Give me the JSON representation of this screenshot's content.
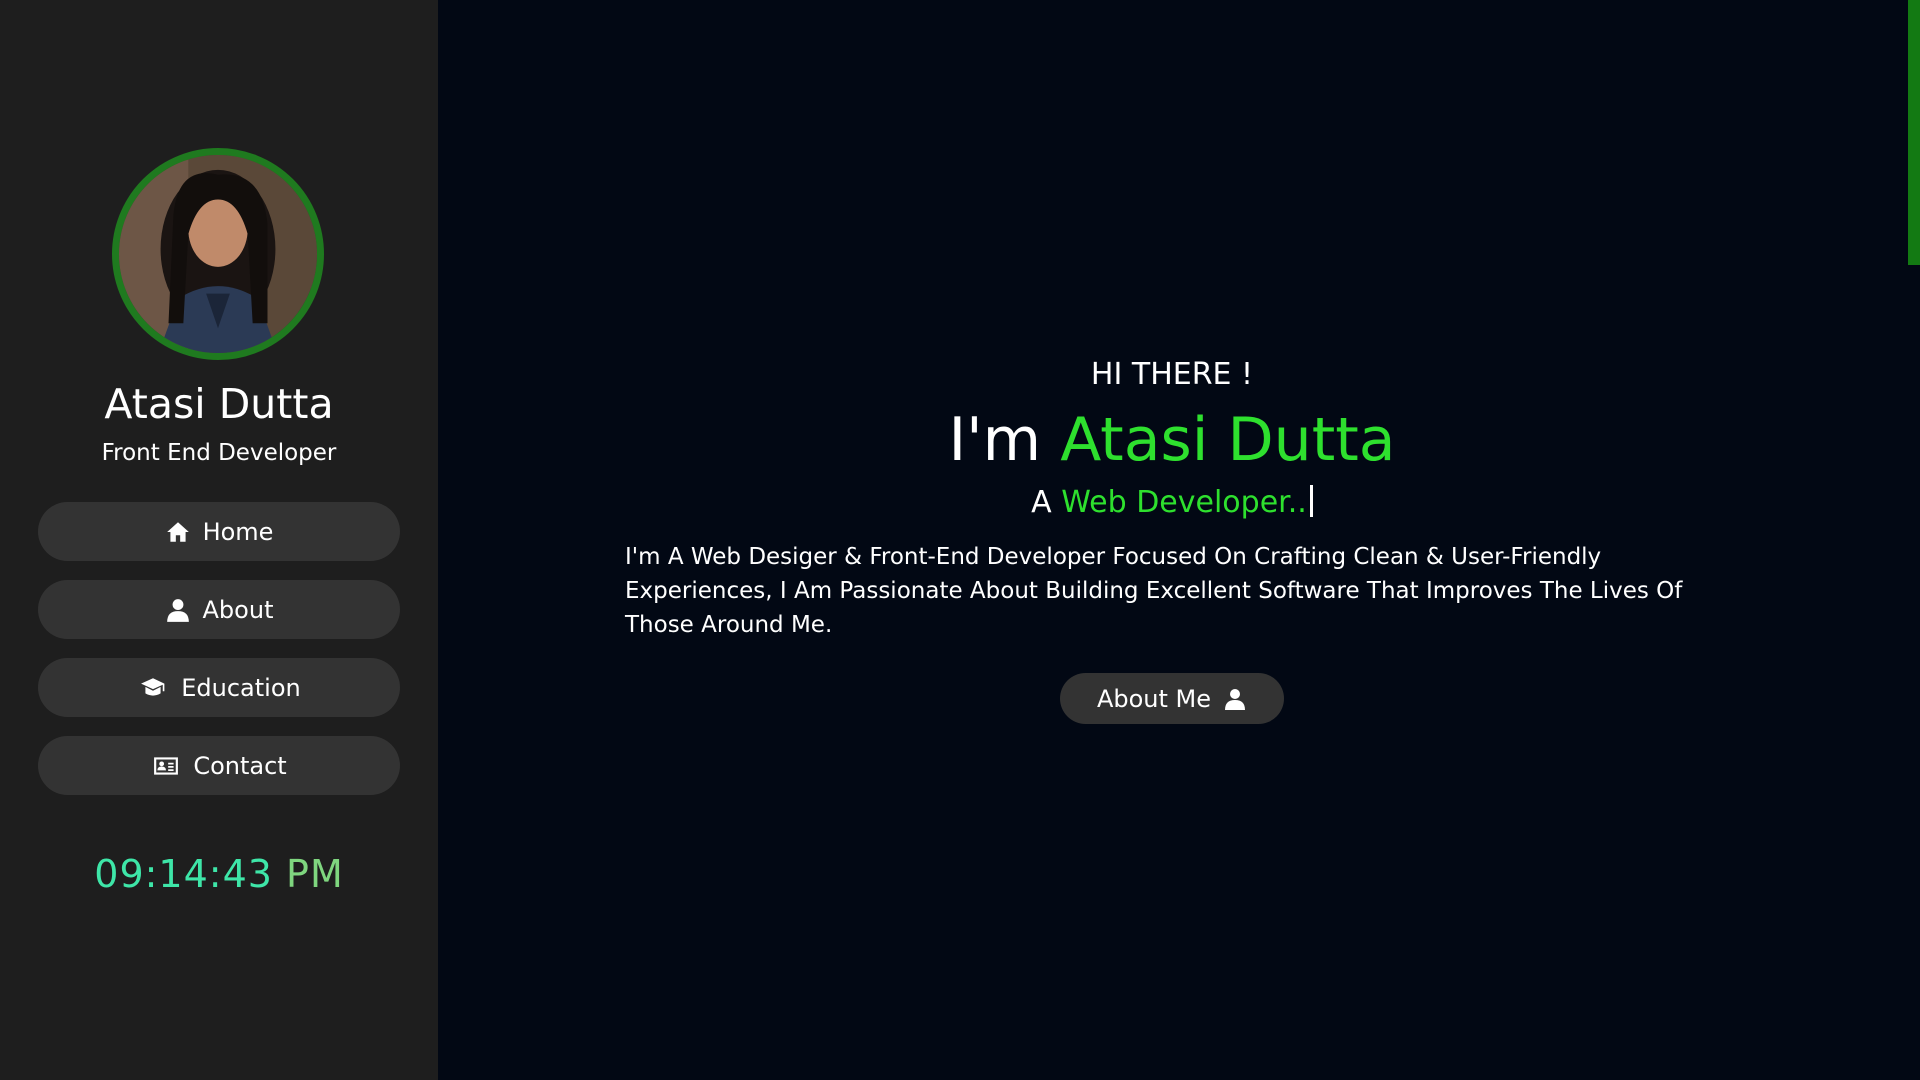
{
  "sidebar": {
    "name": "Atasi Dutta",
    "role": "Front End Developer",
    "nav": [
      {
        "label": "Home",
        "icon": "home-icon"
      },
      {
        "label": "About",
        "icon": "user-icon"
      },
      {
        "label": "Education",
        "icon": "graduation-cap-icon"
      },
      {
        "label": "Contact",
        "icon": "contact-card-icon"
      }
    ],
    "clock": {
      "time": "09:14:43",
      "ampm": "PM"
    }
  },
  "hero": {
    "greeting": "HI THERE !",
    "intro_prefix": "I'm",
    "intro_name": "Atasi Dutta",
    "sub_prefix": "A",
    "sub_highlight": "Web Developer..",
    "description": "I'm A Web Desiger & Front-End Developer Focused On Crafting Clean & User-Friendly Experiences, I Am Passionate About Building Excellent Software That Improves The Lives Of Those Around Me.",
    "button_label": "About Me",
    "button_icon": "user-icon"
  },
  "colors": {
    "accent": "#2ee02e",
    "sidebar_bg": "#1e1e1e",
    "main_bg": "#020814",
    "button_bg": "#333333",
    "avatar_border": "#1f7a1f",
    "clock_time": "#3ee6a8",
    "scrollbar": "#137a13"
  }
}
